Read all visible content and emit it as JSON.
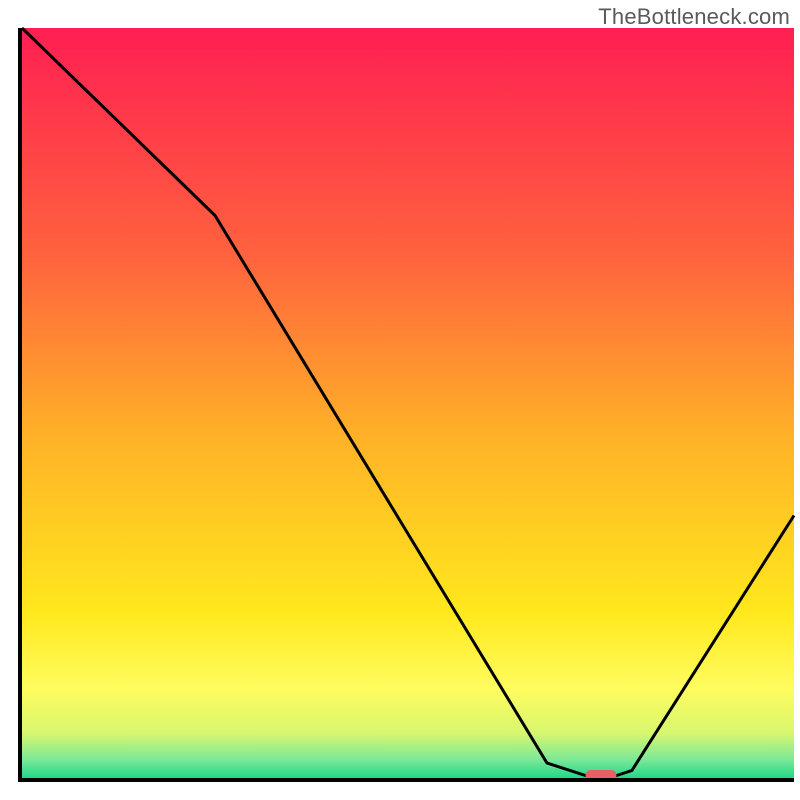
{
  "watermark": "TheBottleneck.com",
  "chart_data": {
    "type": "line",
    "title": "",
    "xlabel": "",
    "ylabel": "",
    "xlim": [
      0,
      100
    ],
    "ylim": [
      0,
      100
    ],
    "x": [
      0,
      25,
      68,
      74,
      76,
      79,
      100
    ],
    "values": [
      100,
      75,
      2,
      0,
      0,
      1,
      35
    ],
    "marker": {
      "x_start": 73,
      "x_end": 77,
      "y": 0
    },
    "background_gradient": {
      "stops": [
        {
          "pos": 0.0,
          "color": "#ff1f52"
        },
        {
          "pos": 0.3,
          "color": "#ff613e"
        },
        {
          "pos": 0.55,
          "color": "#ffb327"
        },
        {
          "pos": 0.78,
          "color": "#ffe81d"
        },
        {
          "pos": 0.88,
          "color": "#fffc5e"
        },
        {
          "pos": 0.94,
          "color": "#d8f76f"
        },
        {
          "pos": 0.975,
          "color": "#7de997"
        },
        {
          "pos": 1.0,
          "color": "#22d88a"
        }
      ]
    }
  }
}
